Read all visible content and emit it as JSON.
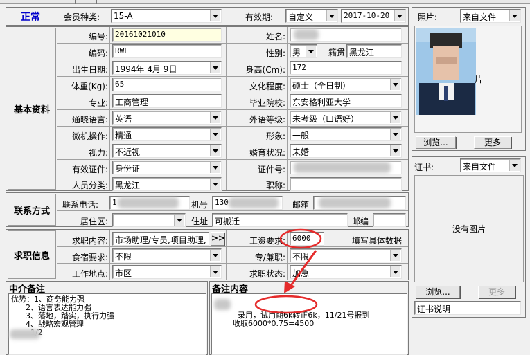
{
  "header": {
    "tab_label": "正常"
  },
  "labels": {
    "membership_type": "会员种类:",
    "validity": "有效期:",
    "number": "编号:",
    "name": "姓名:",
    "code": "编码:",
    "gender": "性别:",
    "native_place": "籍贯",
    "birth_date": "出生日期:",
    "height": "身高(Cm):",
    "weight": "体重(Kg):",
    "education": "文化程度:",
    "major": "专业:",
    "graduate_school": "毕业院校:",
    "language": "通晓语言:",
    "foreign_level": "外语等级:",
    "computer_skill": "微机操作:",
    "appearance": "形象:",
    "vision": "视力:",
    "marital": "婚育状况:",
    "id_document": "有效证件:",
    "id_number": "证件号:",
    "person_category": "人员分类:",
    "title": "职称:",
    "phone": "联系电话:",
    "mobile": "机号",
    "email": "邮箱",
    "residence_area": "居住区:",
    "address": "住址",
    "postcode": "邮编",
    "job_content": "求职内容:",
    "salary": "工资要求:",
    "salary_hint": "填写具体数据",
    "meal_accommodation": "食宿要求:",
    "fulltime_parttime": "专/兼职:",
    "work_location": "工作地点:",
    "job_status": "求职状态:"
  },
  "sections": {
    "basic_info": "基本资料",
    "contact": "联系方式",
    "job_info": "求职信息",
    "agency_notes": "中介备注",
    "notes_content": "备注内容"
  },
  "values": {
    "membership_type": "15-A",
    "validity_type": "自定义",
    "validity_date": "2017-10-20",
    "number": "20161021010",
    "name": "",
    "code": "RWL",
    "gender": "男",
    "native_place": "黑龙江",
    "birth_date": "1994年 4月 9日",
    "height": "172",
    "weight": "65",
    "education": "硕士（全日制）",
    "major": "工商管理",
    "graduate_school": "东安格利亚大学",
    "language": "英语",
    "foreign_level": "未考级（口语好）",
    "computer_skill": "精通",
    "appearance": "一般",
    "vision": "不近视",
    "marital": "未婚",
    "id_document": "身份证",
    "id_number": "",
    "person_category": "黑龙江",
    "title": "",
    "phone": "1",
    "mobile": "130",
    "email": "",
    "residence_area": "",
    "address": "可搬迁",
    "postcode": "",
    "job_content": "市场助理/专员,项目助理,",
    "salary": "6000",
    "meal_accommodation": "不限",
    "fulltime_parttime": "不限",
    "work_location": "市区",
    "job_status": "加急"
  },
  "buttons": {
    "more_jobs": ">>",
    "photo_browse": "浏览...",
    "photo_more": "更多",
    "cert_browse": "浏览...",
    "cert_more": "更多"
  },
  "photo": {
    "label": "照片:",
    "source": "来自文件",
    "overlay_char": "片"
  },
  "certificate": {
    "label": "证书:",
    "source": "来自文件",
    "no_image": "没有图片",
    "description": "证书说明"
  },
  "agency_notes_text": "优势：1、商务能力强\n      2、语言表达能力强\n      3、落地，踏实，执行力强\n      4、战略宏观管理\n        1/2",
  "remarks_text": "录用，试用期6k转正6k，11/21号报到\n收取6000*0.75=4500",
  "colors": {
    "header_blue": "#0000cc",
    "annotation_red": "#e52b2b",
    "yellow_field": "#ffffe1"
  }
}
